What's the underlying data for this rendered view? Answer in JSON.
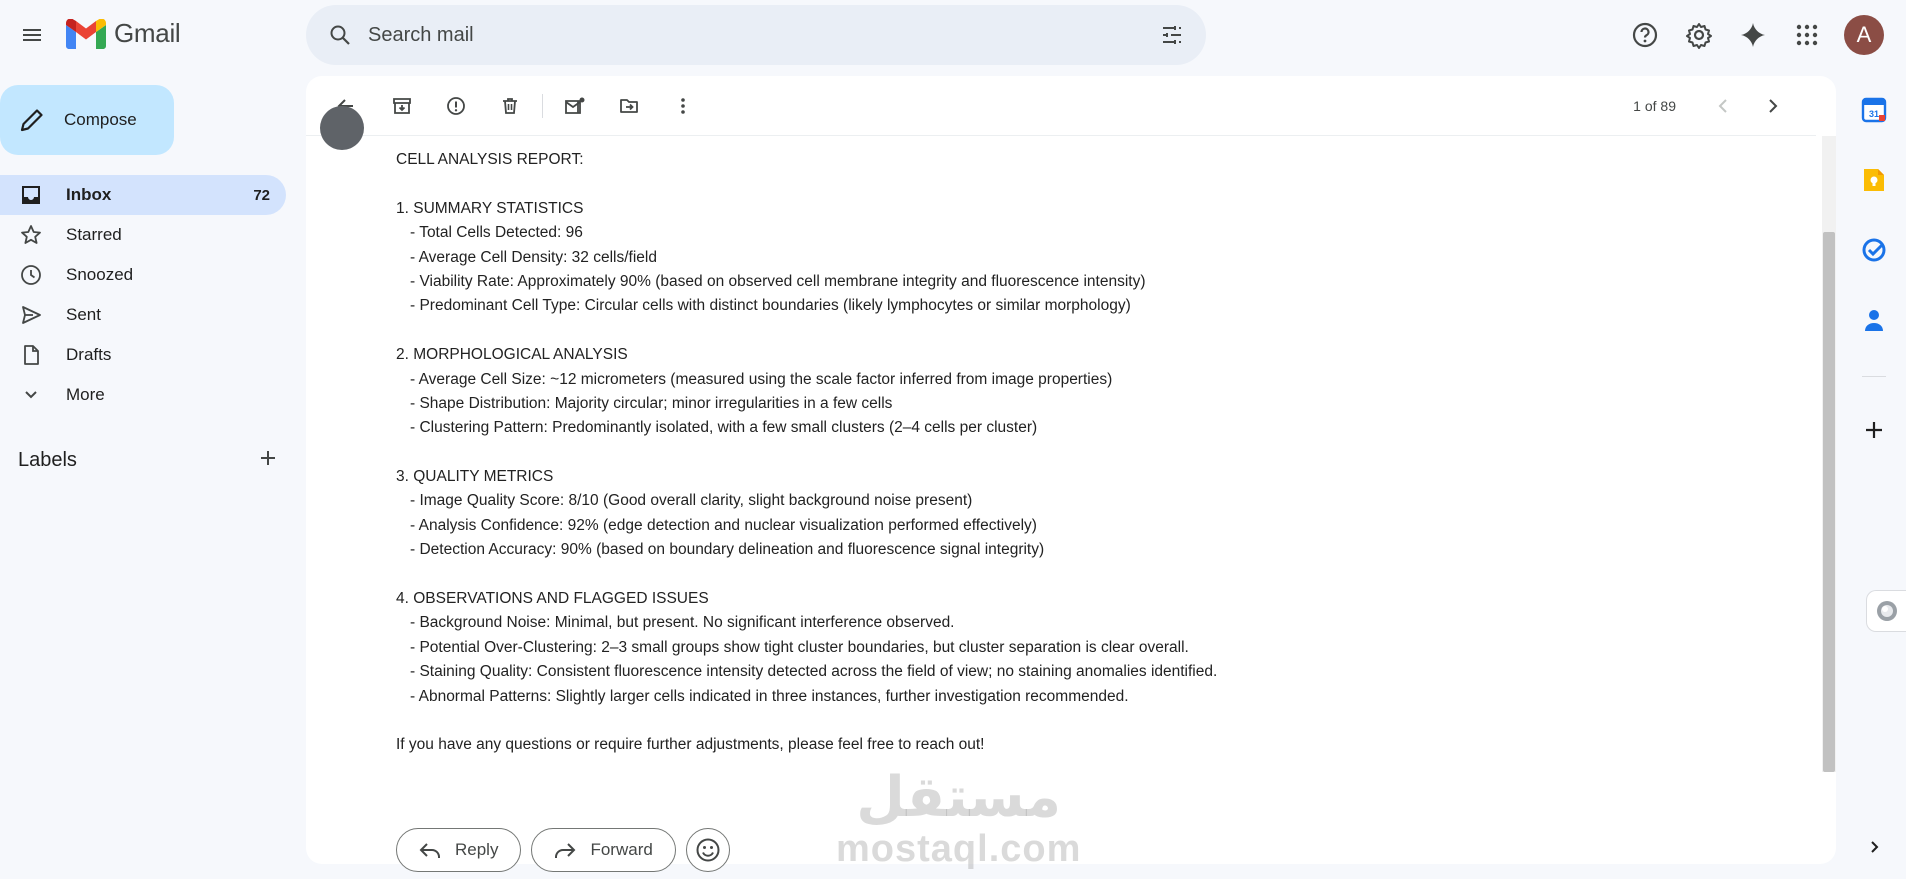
{
  "app": {
    "name": "Gmail",
    "colors": {
      "accent": "#0b57d0",
      "compose_bg": "#c2e7ff",
      "active_nav": "#d3e3fd",
      "avatar_bg": "#8b4d45"
    }
  },
  "header": {
    "search_placeholder": "Search mail",
    "avatar_letter": "A",
    "icons": [
      "menu-icon",
      "search-icon",
      "tune-icon",
      "help-icon",
      "gear-icon",
      "sparkle-icon",
      "apps-grid-icon"
    ]
  },
  "sidebar": {
    "compose_label": "Compose",
    "items": [
      {
        "label": "Inbox",
        "count": "72",
        "icon": "inbox-icon"
      },
      {
        "label": "Starred",
        "count": "",
        "icon": "star-icon"
      },
      {
        "label": "Snoozed",
        "count": "",
        "icon": "clock-icon"
      },
      {
        "label": "Sent",
        "count": "",
        "icon": "send-icon"
      },
      {
        "label": "Drafts",
        "count": "",
        "icon": "draft-icon"
      },
      {
        "label": "More",
        "count": "",
        "icon": "chevron-down-icon"
      }
    ],
    "labels_title": "Labels"
  },
  "toolbar": {
    "pager_text": "1 of 89"
  },
  "email": {
    "lines": [
      {
        "text": "CELL ANALYSIS REPORT:",
        "indent": false
      },
      {
        "text": "",
        "indent": false
      },
      {
        "text": "1. SUMMARY STATISTICS",
        "indent": false
      },
      {
        "text": "- Total Cells Detected: 96",
        "indent": true
      },
      {
        "text": "- Average Cell Density: 32 cells/field",
        "indent": true
      },
      {
        "text": "- Viability Rate: Approximately 90% (based on observed cell membrane integrity and fluorescence intensity)",
        "indent": true
      },
      {
        "text": "- Predominant Cell Type: Circular cells with distinct boundaries (likely lymphocytes or similar morphology)",
        "indent": true
      },
      {
        "text": "",
        "indent": false
      },
      {
        "text": "2. MORPHOLOGICAL ANALYSIS",
        "indent": false
      },
      {
        "text": "- Average Cell Size: ~12 micrometers (measured using the scale factor inferred from image properties)",
        "indent": true
      },
      {
        "text": "- Shape Distribution: Majority circular; minor irregularities in a few cells",
        "indent": true
      },
      {
        "text": "- Clustering Pattern: Predominantly isolated, with a few small clusters (2–4 cells per cluster)",
        "indent": true
      },
      {
        "text": "",
        "indent": false
      },
      {
        "text": "3. QUALITY METRICS",
        "indent": false
      },
      {
        "text": "- Image Quality Score: 8/10 (Good overall clarity, slight background noise present)",
        "indent": true
      },
      {
        "text": "- Analysis Confidence: 92% (edge detection and nuclear visualization performed effectively)",
        "indent": true
      },
      {
        "text": "- Detection Accuracy: 90% (based on boundary delineation and fluorescence signal integrity)",
        "indent": true
      },
      {
        "text": "",
        "indent": false
      },
      {
        "text": "4. OBSERVATIONS AND FLAGGED ISSUES",
        "indent": false
      },
      {
        "text": "- Background Noise: Minimal, but present. No significant interference observed.",
        "indent": true
      },
      {
        "text": "- Potential Over-Clustering: 2–3 small groups show tight cluster boundaries, but cluster separation is clear overall.",
        "indent": true
      },
      {
        "text": "- Staining Quality: Consistent fluorescence intensity detected across the field of view; no staining anomalies identified.",
        "indent": true
      },
      {
        "text": "- Abnormal Patterns: Slightly larger cells indicated in three instances, further investigation recommended.",
        "indent": true
      },
      {
        "text": "",
        "indent": false
      },
      {
        "text": "If you have any questions or require further adjustments, please feel free to reach out!",
        "indent": false
      }
    ],
    "reply_label": "Reply",
    "forward_label": "Forward"
  },
  "watermark": {
    "arabic": "مستقل",
    "latin": "mostaql.com"
  },
  "side_panel": {
    "icons": [
      "calendar-icon",
      "keep-icon",
      "tasks-icon",
      "contacts-icon",
      "add-icon"
    ],
    "calendar_day": "31"
  }
}
